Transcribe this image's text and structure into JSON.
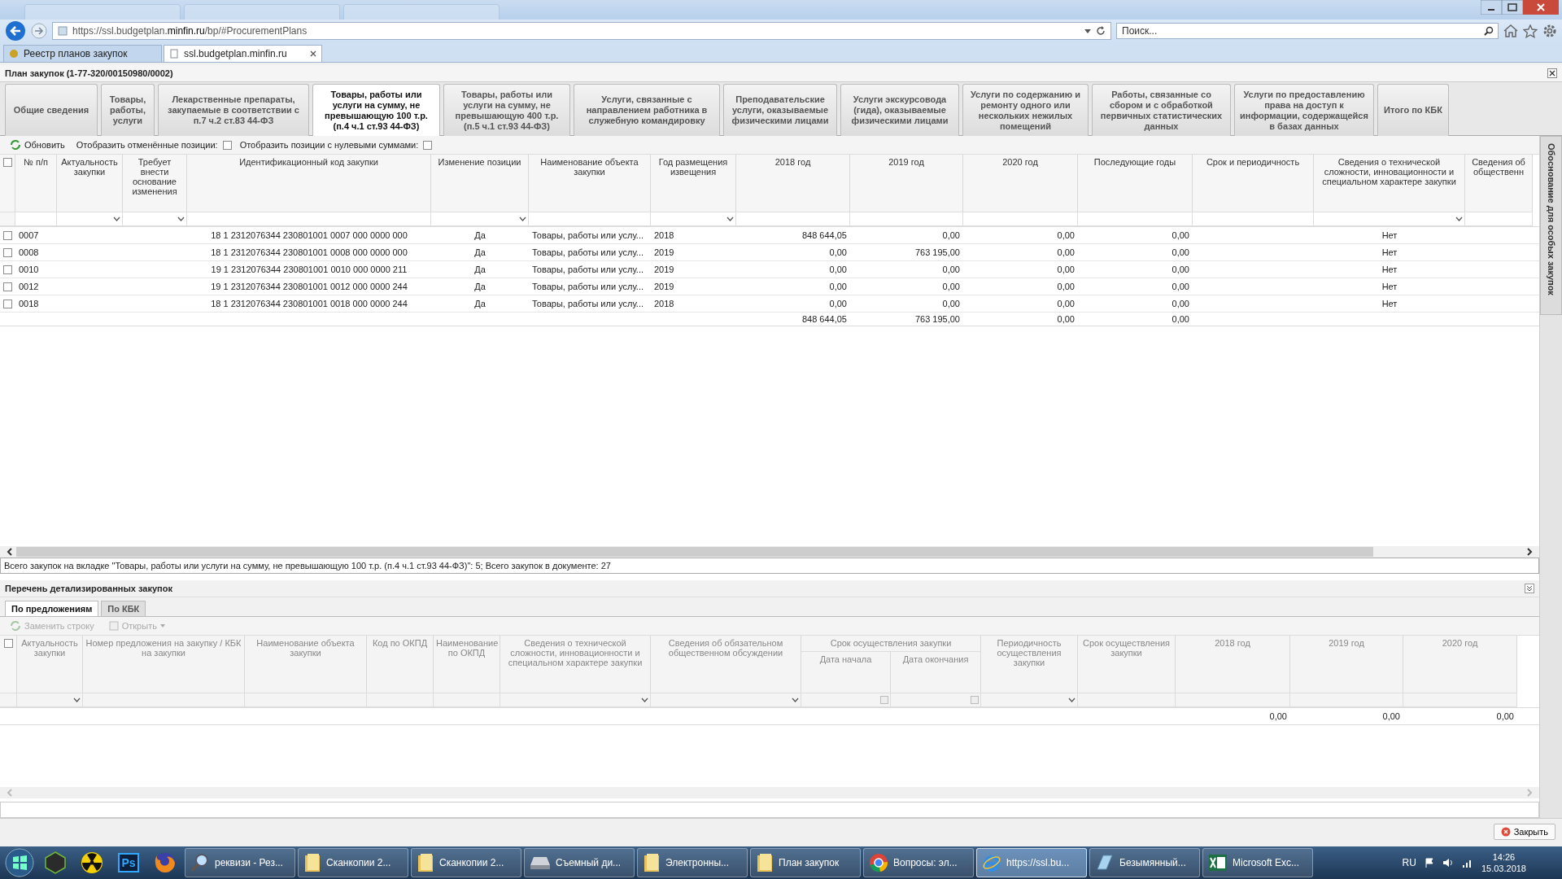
{
  "browser": {
    "address": "https://ssl.budgetplan.**minfin.ru**/bp/#ProcurementPlans",
    "search_placeholder": "Поиск...",
    "tabs": [
      {
        "label": "Реестр планов закупок",
        "selected": false
      },
      {
        "label": "ssl.budgetplan.minfin.ru",
        "selected": true
      }
    ]
  },
  "app": {
    "title": "План закупок (1-77-320/00150980/0002)",
    "tabs": [
      {
        "label": "Общие сведения",
        "selected": false
      },
      {
        "label": "Товары, работы, услуги",
        "selected": false
      },
      {
        "label": "Лекарственные препараты, закупаемые в соответствии с п.7 ч.2 ст.83 44-ФЗ",
        "selected": false
      },
      {
        "label": "Товары, работы или услуги на сумму, не превышающую 100 т.р. (п.4 ч.1 ст.93 44-ФЗ)",
        "selected": true
      },
      {
        "label": "Товары, работы или услуги на сумму, не превышающую 400 т.р. (п.5 ч.1 ст.93 44-ФЗ)",
        "selected": false
      },
      {
        "label": "Услуги, связанные с направлением работника в служебную командировку",
        "selected": false
      },
      {
        "label": "Преподавательские услуги, оказываемые физическими лицами",
        "selected": false
      },
      {
        "label": "Услуги экскурсовода (гида), оказываемые физическими лицами",
        "selected": false
      },
      {
        "label": "Услуги по содержанию и ремонту одного или нескольких нежилых помещений",
        "selected": false
      },
      {
        "label": "Работы, связанные со сбором и с обработкой первичных статистических данных",
        "selected": false
      },
      {
        "label": "Услуги по предоставлению права на доступ к информации, содержащейся в базах данных",
        "selected": false
      },
      {
        "label": "Итого по КБК",
        "selected": false
      }
    ],
    "side_tab": "Обоснование для особых закупок",
    "toolbar": {
      "refresh": "Обновить",
      "options": [
        {
          "label": "Отобразить отменённые позиции:",
          "checked": false
        },
        {
          "label": "Отобразить позиции с нулевыми суммами:",
          "checked": false
        }
      ]
    },
    "table": {
      "select_all_checked": false,
      "columns": [
        {
          "label": "№ п/п",
          "kind": "plain"
        },
        {
          "label": "Актуальность закупки",
          "kind": "dropdown"
        },
        {
          "label": "Требует внести основание изменения",
          "kind": "dropdown"
        },
        {
          "label": "Идентификационный код закупки",
          "kind": "plain"
        },
        {
          "label": "Изменение позиции",
          "kind": "dropdown"
        },
        {
          "label": "Наименование объекта закупки",
          "kind": "plain"
        },
        {
          "label": "Год размещения извещения",
          "kind": "dropdown"
        },
        {
          "label": "2018 год",
          "kind": "plain"
        },
        {
          "label": "2019 год",
          "kind": "plain"
        },
        {
          "label": "2020 год",
          "kind": "plain"
        },
        {
          "label": "Последующие годы",
          "kind": "plain"
        },
        {
          "label": "Срок и периодичность",
          "kind": "plain"
        },
        {
          "label": "Сведения о технической сложности, инновационности и специальном характере закупки",
          "kind": "dropdown"
        },
        {
          "label": "Сведения об общественн",
          "kind": "plain"
        }
      ],
      "rows": [
        {
          "checked": false,
          "num": "0007",
          "code": "18 1 2312076344 230801001 0007 000 0000 000",
          "change": "Да",
          "name": "Товары, работы или услу...",
          "year": "2018",
          "y2018": "848 644,05",
          "y2019": "0,00",
          "y2020": "0,00",
          "later": "0,00",
          "tech": "Нет"
        },
        {
          "checked": false,
          "num": "0008",
          "code": "18 1 2312076344 230801001 0008 000 0000 000",
          "change": "Да",
          "name": "Товары, работы или услу...",
          "year": "2019",
          "y2018": "0,00",
          "y2019": "763 195,00",
          "y2020": "0,00",
          "later": "0,00",
          "tech": "Нет"
        },
        {
          "checked": false,
          "num": "0010",
          "code": "19 1 2312076344 230801001 0010 000 0000 211",
          "change": "Да",
          "name": "Товары, работы или услу...",
          "year": "2019",
          "y2018": "0,00",
          "y2019": "0,00",
          "y2020": "0,00",
          "later": "0,00",
          "tech": "Нет"
        },
        {
          "checked": false,
          "num": "0012",
          "code": "19 1 2312076344 230801001 0012 000 0000 244",
          "change": "Да",
          "name": "Товары, работы или услу...",
          "year": "2019",
          "y2018": "0,00",
          "y2019": "0,00",
          "y2020": "0,00",
          "later": "0,00",
          "tech": "Нет"
        },
        {
          "checked": false,
          "num": "0018",
          "code": "18 1 2312076344 230801001 0018 000 0000 244",
          "change": "Да",
          "name": "Товары, работы или услу...",
          "year": "2018",
          "y2018": "0,00",
          "y2019": "0,00",
          "y2020": "0,00",
          "later": "0,00",
          "tech": "Нет"
        }
      ],
      "totals": {
        "y2018": "848 644,05",
        "y2019": "763 195,00",
        "y2020": "0,00",
        "later": "0,00"
      }
    },
    "status": "Всего закупок на вкладке \"Товары, работы или услуги на сумму, не превышающую 100 т.р. (п.4 ч.1 ст.93 44-ФЗ)\": 5; Всего закупок в документе: 27",
    "detail": {
      "title": "Перечень детализированных закупок",
      "tabs": [
        {
          "label": "По предложениям",
          "selected": true
        },
        {
          "label": "По КБК",
          "selected": false
        }
      ],
      "toolbar": [
        {
          "label": "Заменить строку",
          "kind": "replace",
          "disabled": true
        },
        {
          "label": "Открыть",
          "kind": "open",
          "disabled": true
        }
      ],
      "select_all_checked": false,
      "columns": [
        {
          "label": "Актуальность закупки",
          "kind": "dropdown"
        },
        {
          "label": "Номер предложения на закупку / КБК на закупки",
          "kind": "plain"
        },
        {
          "label": "Наименование объекта закупки",
          "kind": "plain"
        },
        {
          "label": "Код по ОКПД",
          "kind": "plain"
        },
        {
          "label": "Наименование по ОКПД",
          "kind": "plain"
        },
        {
          "label": "Сведения о технической сложности, инновационности и специальном характере закупки",
          "kind": "dropdown"
        },
        {
          "label": "Сведения об обязательном общественном обсуждении",
          "kind": "dropdown"
        },
        {
          "label": "Срок осуществления закупки",
          "kind": "group",
          "children": [
            {
              "label": "Дата начала",
              "kind": "date"
            },
            {
              "label": "Дата окончания",
              "kind": "date"
            }
          ]
        },
        {
          "label": "Периодичность осуществления закупки",
          "kind": "dropdown"
        },
        {
          "label": "Срок осуществления закупки",
          "kind": "plain"
        },
        {
          "label": "2018 год",
          "kind": "plain"
        },
        {
          "label": "2019 год",
          "kind": "plain"
        },
        {
          "label": "2020 год",
          "kind": "plain"
        }
      ],
      "totals": {
        "y2018": "0,00",
        "y2019": "0,00",
        "y2020": "0,00"
      }
    },
    "close_button": "Закрыть"
  },
  "taskbar": {
    "pinned": [
      {
        "kind": "nox"
      },
      {
        "kind": "radiation"
      },
      {
        "kind": "ps",
        "label": "Ps"
      },
      {
        "kind": "firefox"
      }
    ],
    "windows": [
      {
        "label": "реквизи - Рез...",
        "kind": "search",
        "selected": false
      },
      {
        "label": "Сканкопии 2...",
        "kind": "folder",
        "selected": false
      },
      {
        "label": "Сканкопии 2...",
        "kind": "folder",
        "selected": false
      },
      {
        "label": "Съемный ди...",
        "kind": "drive",
        "selected": false
      },
      {
        "label": "Электронны...",
        "kind": "folder",
        "selected": false
      },
      {
        "label": "План закупок",
        "kind": "folder",
        "selected": false
      },
      {
        "label": "Вопросы: эл...",
        "kind": "chrome",
        "selected": false
      },
      {
        "label": "https://ssl.bu...",
        "kind": "ie",
        "selected": true
      },
      {
        "label": "Безымянный...",
        "kind": "paint",
        "selected": false
      },
      {
        "label": "Microsoft Exc...",
        "kind": "excel",
        "selected": false
      }
    ],
    "language": "RU",
    "time": "14:26",
    "date": "15.03.2018"
  }
}
